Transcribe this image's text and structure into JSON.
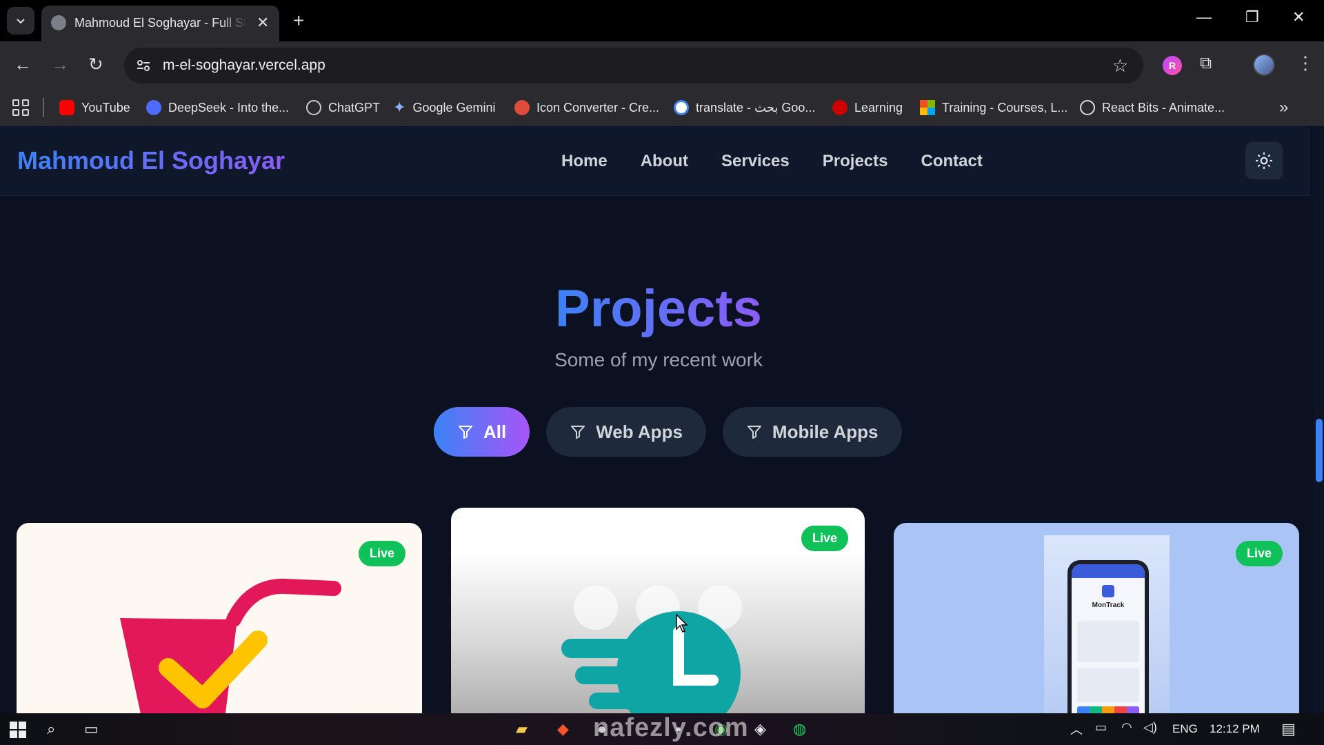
{
  "browser": {
    "tab_title": "Mahmoud El Soghayar - Full Stack",
    "url": "m-el-soghayar.vercel.app",
    "bookmarks": [
      {
        "label": "YouTube",
        "color": "#ff0000"
      },
      {
        "label": "DeepSeek - Into the...",
        "color": "#4d6bfe"
      },
      {
        "label": "ChatGPT",
        "color": "#cccccc"
      },
      {
        "label": "Google Gemini",
        "color": "#8ab4f8"
      },
      {
        "label": "Icon Converter - Cre...",
        "color": "#e04b3c"
      },
      {
        "label": "translate - بحث Goo...",
        "color": "#ffffff"
      },
      {
        "label": "Learning",
        "color": "#cc0000"
      },
      {
        "label": "Training - Courses, L...",
        "color": "#f25022"
      },
      {
        "label": "React Bits - Animate...",
        "color": "#dddddd"
      }
    ]
  },
  "site": {
    "brand": "Mahmoud El Soghayar",
    "nav": [
      "Home",
      "About",
      "Services",
      "Projects",
      "Contact"
    ],
    "accent_from": "#3b82f6",
    "accent_to": "#8b5cf6"
  },
  "projects": {
    "title": "Projects",
    "subtitle": "Some of my recent work",
    "filters": [
      {
        "label": "All",
        "active": true
      },
      {
        "label": "Web Apps",
        "active": false
      },
      {
        "label": "Mobile Apps",
        "active": false
      }
    ],
    "cards": [
      {
        "badge": "Live"
      },
      {
        "badge": "Live"
      },
      {
        "badge": "Live",
        "screen_app": "MonTrack"
      }
    ]
  },
  "taskbar": {
    "lang": "ENG",
    "time": "12:12 PM",
    "watermark": "nafezly.com"
  }
}
